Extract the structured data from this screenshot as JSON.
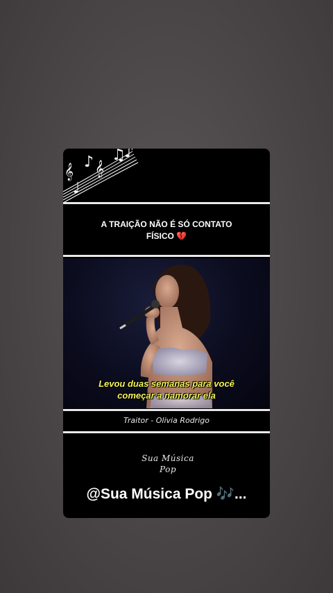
{
  "post": {
    "headline_line1": "A TRAIÇÃO NÃO É SÓ CONTATO",
    "headline_line2": "FÍSICO",
    "headline_emoji": "💔",
    "subtitle_line1": "Levou duas semanas para você",
    "subtitle_line2": "começar a namorar ela",
    "song_caption": "Traitor - Olivia Rodrigo",
    "logo_line1": "Sua Música",
    "logo_line2": "Pop",
    "handle_text": "@Sua Música Pop",
    "handle_emoji": "🎶",
    "handle_ellipsis": "..."
  },
  "colors": {
    "background": "#4a4547",
    "card": "#000000",
    "divider": "#e9e9e9",
    "subtitle": "#f3f35a"
  },
  "icons": [
    "music-notes-decoration",
    "broken-heart-emoji",
    "music-notes-emoji"
  ]
}
